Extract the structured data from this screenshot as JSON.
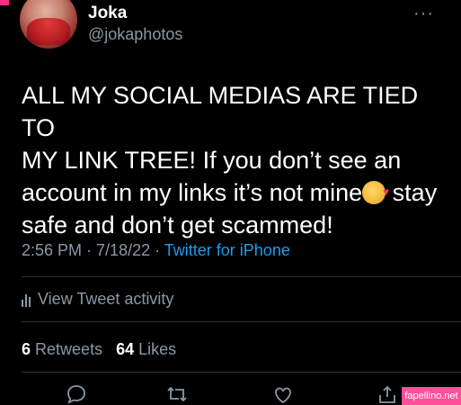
{
  "author": {
    "name": "Joka",
    "handle": "@jokaphotos"
  },
  "tweet": {
    "line1": "ALL MY SOCIAL MEDIAS ARE TIED TO",
    "line2": "MY LINK TREE! If you don’t see an",
    "line3a": "account in my links it’s not mine",
    "line3b": " stay",
    "line4": "safe and don’t get scammed!",
    "emoji_icon": "smiling-face-with-hearts-icon"
  },
  "meta": {
    "time": "2:56 PM",
    "sep1": " · ",
    "date": "7/18/22",
    "sep2": " · ",
    "source": "Twitter for iPhone"
  },
  "activity": {
    "label": "View Tweet activity"
  },
  "stats": {
    "retweets_count": "6",
    "retweets_label": "Retweets",
    "likes_count": "64",
    "likes_label": "Likes"
  },
  "actions": [
    "reply-icon",
    "retweet-icon",
    "like-icon",
    "share-icon"
  ],
  "watermark": {
    "text": "fapellino.net"
  },
  "colors": {
    "background": "#000000",
    "text": "#ffffff",
    "secondary": "#8b98a5",
    "link": "#1d9bf0",
    "watermark": "#ff4f9a"
  }
}
